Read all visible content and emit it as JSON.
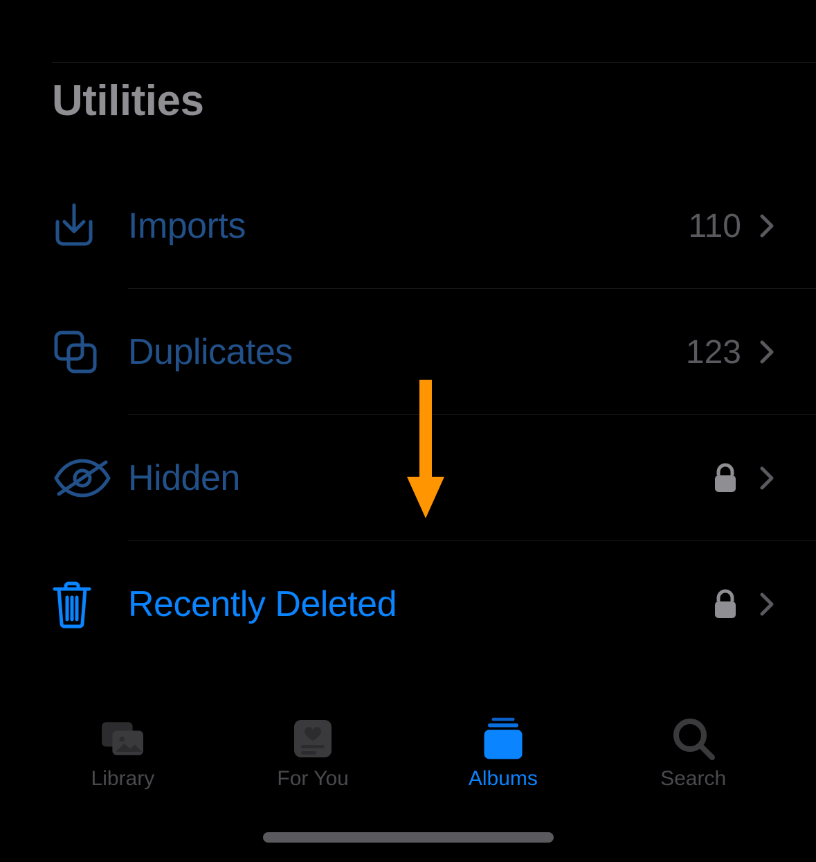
{
  "section_title": "Utilities",
  "rows": [
    {
      "label": "Imports",
      "count": "110",
      "locked": false
    },
    {
      "label": "Duplicates",
      "count": "123",
      "locked": false
    },
    {
      "label": "Hidden",
      "count": "",
      "locked": true
    },
    {
      "label": "Recently Deleted",
      "count": "",
      "locked": true
    }
  ],
  "tabs": [
    {
      "label": "Library"
    },
    {
      "label": "For You"
    },
    {
      "label": "Albums"
    },
    {
      "label": "Search"
    }
  ]
}
